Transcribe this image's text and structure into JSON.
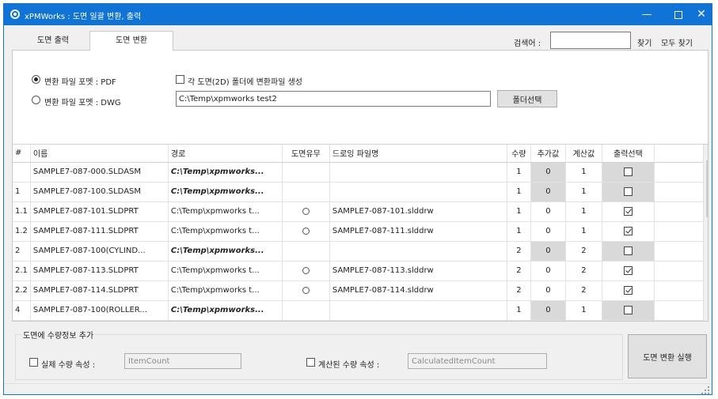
{
  "window": {
    "title": "xPMWorks : 도면 일괄 변환, 출력",
    "icons": {
      "app": "app-logo-icon",
      "minimize": "minimize-icon",
      "maximize": "maximize-icon",
      "close": "close-icon"
    }
  },
  "tabs": [
    {
      "label": "도면 출력",
      "active": false
    },
    {
      "label": "도면 변환",
      "active": true
    }
  ],
  "search": {
    "label": "검색어 :",
    "value": "",
    "find_label": "찾기",
    "find_all_label": "모두 찾기"
  },
  "options": {
    "format_pdf_label": "변환 파일 포멧 : PDF",
    "format_pdf_selected": true,
    "format_dwg_label": "변환 파일 포멧 : DWG",
    "format_dwg_selected": false,
    "per_folder_label": "각 도면(2D) 폴더에 변환파일 생성",
    "per_folder_checked": false,
    "output_path": "C:\\Temp\\xpmworks test2",
    "folder_button_label": "폴더선택"
  },
  "grid": {
    "columns": [
      "#",
      "이름",
      "경로",
      "도면유무",
      "드로잉 파일명",
      "수량",
      "추가값",
      "계산값",
      "출력선택"
    ],
    "rows": [
      {
        "no": "",
        "name": "SAMPLE7-087-000.SLDASM",
        "path": "C:\\Temp\\xpmworks...",
        "path_bold": true,
        "has_drawing": false,
        "drawing": "",
        "qty": "1",
        "add": "0",
        "calc": "1",
        "selected": false
      },
      {
        "no": "1",
        "name": "SAMPLE7-087-100.SLDASM",
        "path": "C:\\Temp\\xpmworks...",
        "path_bold": true,
        "has_drawing": false,
        "drawing": "",
        "qty": "1",
        "add": "0",
        "calc": "1",
        "selected": false
      },
      {
        "no": "1.1",
        "name": "SAMPLE7-087-101.SLDPRT",
        "path": "C:\\Temp\\xpmworks t...",
        "path_bold": false,
        "has_drawing": true,
        "drawing": "SAMPLE7-087-101.slddrw",
        "qty": "1",
        "add": "0",
        "calc": "1",
        "selected": true
      },
      {
        "no": "1.2",
        "name": "SAMPLE7-087-111.SLDPRT",
        "path": "C:\\Temp\\xpmworks t...",
        "path_bold": false,
        "has_drawing": true,
        "drawing": "SAMPLE7-087-111.slddrw",
        "qty": "1",
        "add": "0",
        "calc": "1",
        "selected": true
      },
      {
        "no": "2",
        "name": "SAMPLE7-087-100(CYLIND...",
        "path": "C:\\Temp\\xpmworks...",
        "path_bold": true,
        "has_drawing": false,
        "drawing": "",
        "qty": "2",
        "add": "0",
        "calc": "2",
        "selected": false
      },
      {
        "no": "2.1",
        "name": "SAMPLE7-087-113.SLDPRT",
        "path": "C:\\Temp\\xpmworks t...",
        "path_bold": false,
        "has_drawing": true,
        "drawing": "SAMPLE7-087-113.slddrw",
        "qty": "2",
        "add": "0",
        "calc": "2",
        "selected": true
      },
      {
        "no": "2.2",
        "name": "SAMPLE7-087-114.SLDPRT",
        "path": "C:\\Temp\\xpmworks t...",
        "path_bold": false,
        "has_drawing": true,
        "drawing": "SAMPLE7-087-114.slddrw",
        "qty": "2",
        "add": "0",
        "calc": "2",
        "selected": true
      },
      {
        "no": "4",
        "name": "SAMPLE7-087-100(ROLLER...",
        "path": "C:\\Temp\\xpmworks...",
        "path_bold": true,
        "has_drawing": false,
        "drawing": "",
        "qty": "1",
        "add": "0",
        "calc": "1",
        "selected": false
      }
    ]
  },
  "qty_info": {
    "group_title": "도면에 수량정보 추가",
    "actual_label": "실제 수량 속성 :",
    "actual_checked": false,
    "actual_value": "ItemCount",
    "calc_label": "계산된 수량 속성 :",
    "calc_checked": false,
    "calc_value": "CalculatedItemCount"
  },
  "run_button_label": "도면 변환 실행",
  "colors": {
    "titlebar": "#0f74d6",
    "readonly_cell": "#d9d9d9"
  }
}
